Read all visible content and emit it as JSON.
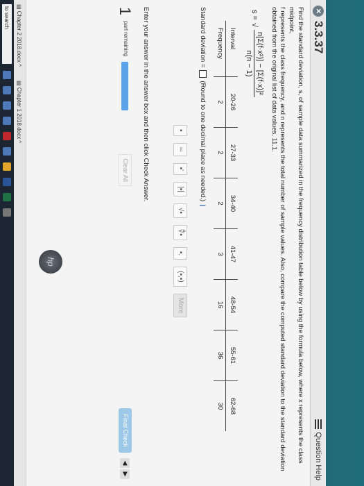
{
  "header": {
    "question_number": "3.3.37",
    "help_label": "Question Help"
  },
  "prompt": {
    "line1": "Find the standard deviation, s, of sample data summarized in the frequency distribution table below by using the formula below, where x represents the class midpoint,",
    "line2": "f represents the class frequency, and n represents the total number of sample values. Also, compare the computed standard deviation to the standard deviation",
    "line3": "obtained from the original list of data values, 11.1."
  },
  "formula": {
    "lhs": "s =",
    "numerator": "n[Σ(f·x²)] − [Σ(f·x)]²",
    "denominator": "n(n − 1)"
  },
  "table": {
    "row_labels": [
      "Interval",
      "Frequency"
    ],
    "intervals": [
      "20-26",
      "27-33",
      "34-40",
      "41-47",
      "48-54",
      "55-61",
      "62-68"
    ],
    "frequencies": [
      "2",
      "2",
      "2",
      "3",
      "16",
      "36",
      "30"
    ]
  },
  "answer": {
    "label": "Standard deviation =",
    "hint": "(Round to one decimal place as needed.)"
  },
  "toolbar": {
    "buttons": [
      "▪",
      "▫▫",
      "▪'",
      "|▪|",
      "√▪",
      "∜▪",
      "▪.",
      "(▪,▪)"
    ],
    "more": "More"
  },
  "instruction": "Enter your answer in the answer box and then click Check Answer.",
  "footer": {
    "parts_count": "1",
    "parts_label": "part remaining",
    "clear_all": "Clear All",
    "final_check": "Final Check"
  },
  "downloads": [
    "Chapter 2 2018.docx",
    "Chapter 1 2018.docx"
  ],
  "taskbar": {
    "search_placeholder": "to search"
  },
  "brand": "hp"
}
